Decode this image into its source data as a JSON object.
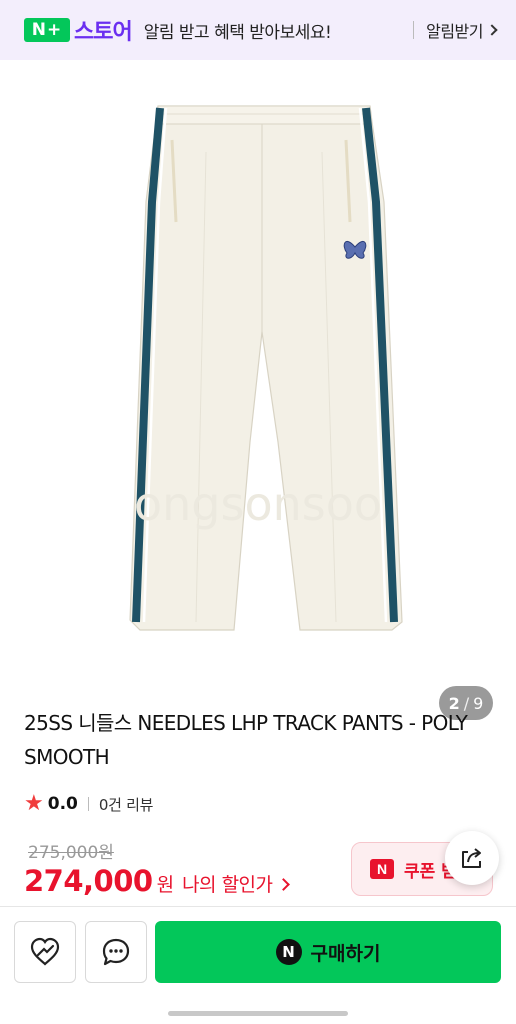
{
  "banner": {
    "logo_badge": "N+",
    "logo_word": "스토어",
    "message": "알림 받고 혜택 받아보세요!",
    "link_label": "알림받기"
  },
  "gallery": {
    "current": "2",
    "separator": "/",
    "total": "9",
    "watermark": "ongsonsoo"
  },
  "product": {
    "title": "25SS 니들스 NEEDLES LHP TRACK PANTS - POLY SMOOTH",
    "rating": "0.0",
    "review_count": "0건 리뷰",
    "original_price": "275,000원",
    "price": "274,000",
    "price_unit": "원",
    "my_discount_label": "나의 할인가",
    "coupon_badge": "N",
    "coupon_label": "쿠폰 받기"
  },
  "bottom_bar": {
    "buy_badge": "N",
    "buy_label": "구매하기"
  },
  "colors": {
    "naver_green": "#03c75a",
    "store_purple": "#6b2ff0",
    "price_red": "#e8132d",
    "stripe_teal": "#1f5266",
    "pants_ivory": "#f3f0e6"
  },
  "icons": [
    "chevron-right-icon",
    "star-icon",
    "wishlist-heart-icon",
    "chat-bubble-icon",
    "share-icon",
    "naver-n-icon"
  ]
}
